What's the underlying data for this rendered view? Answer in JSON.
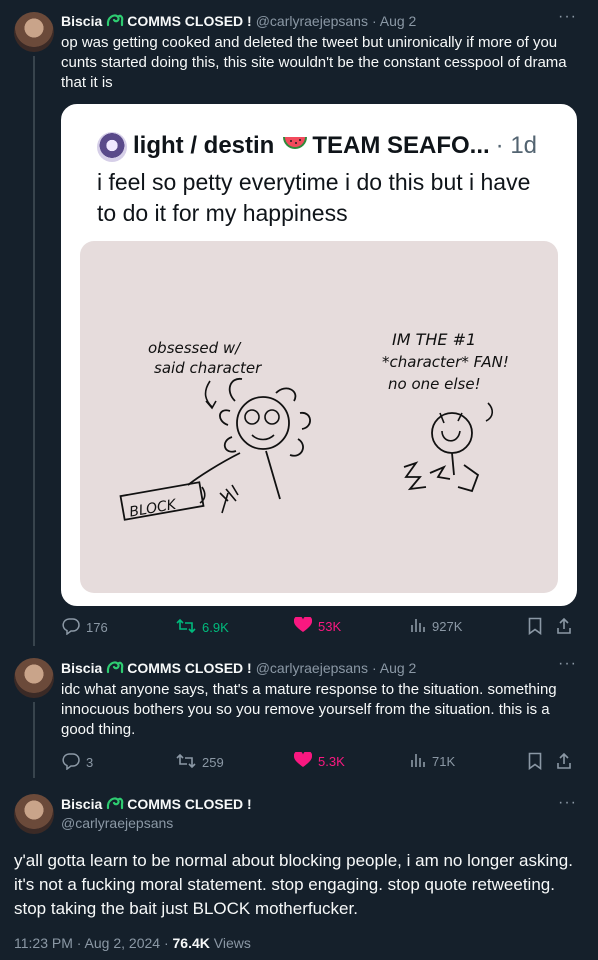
{
  "tweet1": {
    "name": "Biscia",
    "badge": "COMMS CLOSED !",
    "handle": "@carlyraejepsans",
    "time": "· Aug 2",
    "text": "op was getting cooked and deleted the tweet but unironically if more of you cunts started doing this, this site wouldn't be the constant cesspool of drama that it is",
    "quote": {
      "name": "light / destin",
      "name_suffix": "TEAM SEAFO...",
      "time": "· 1d",
      "text": "i feel so petty everytime i do this but i have to do it for my happiness",
      "drawing": {
        "label_left": [
          "obsessed w/",
          "said character"
        ],
        "label_right": [
          "IM THE #1",
          "*character* FAN!",
          "no one else!"
        ],
        "block_button": "BLOCK"
      }
    },
    "stats": {
      "replies": "176",
      "retweets": "6.9K",
      "likes": "53K",
      "views": "927K"
    }
  },
  "tweet2": {
    "name": "Biscia",
    "badge": "COMMS CLOSED !",
    "handle": "@carlyraejepsans",
    "time": "· Aug 2",
    "text": "idc what anyone says, that's a mature response to the situation. something innocuous bothers you so you remove yourself from the situation. this is a good thing.",
    "stats": {
      "replies": "3",
      "retweets": "259",
      "likes": "5.3K",
      "views": "71K"
    }
  },
  "tweet3": {
    "name": "Biscia",
    "badge": "COMMS CLOSED !",
    "handle": "@carlyraejepsans",
    "text": "y'all gotta learn to be normal about blocking people, i am no longer asking. it's not a fucking moral statement. stop engaging. stop quote retweeting. stop taking the bait just BLOCK motherfucker.",
    "timestamp": "11:23 PM · Aug 2, 2024 · ",
    "views_count": "76.4K",
    "views_label": "Views"
  },
  "icons": {
    "more": "more-dots-icon",
    "reply": "reply-icon",
    "retweet": "retweet-icon",
    "like": "heart-icon",
    "views": "views-bar-chart-icon",
    "bookmark": "bookmark-icon",
    "share": "share-icon",
    "badge": "green-swirl-badge-icon",
    "watermelon": "watermelon-emoji-icon"
  },
  "colors": {
    "background": "#15202b",
    "text": "#f7f9f9",
    "muted": "#8b98a5",
    "retweet_active": "#00ba7c",
    "like_active": "#f91880",
    "badge_green": "#2ecc71",
    "drawing_bg": "#e6dcdc"
  }
}
